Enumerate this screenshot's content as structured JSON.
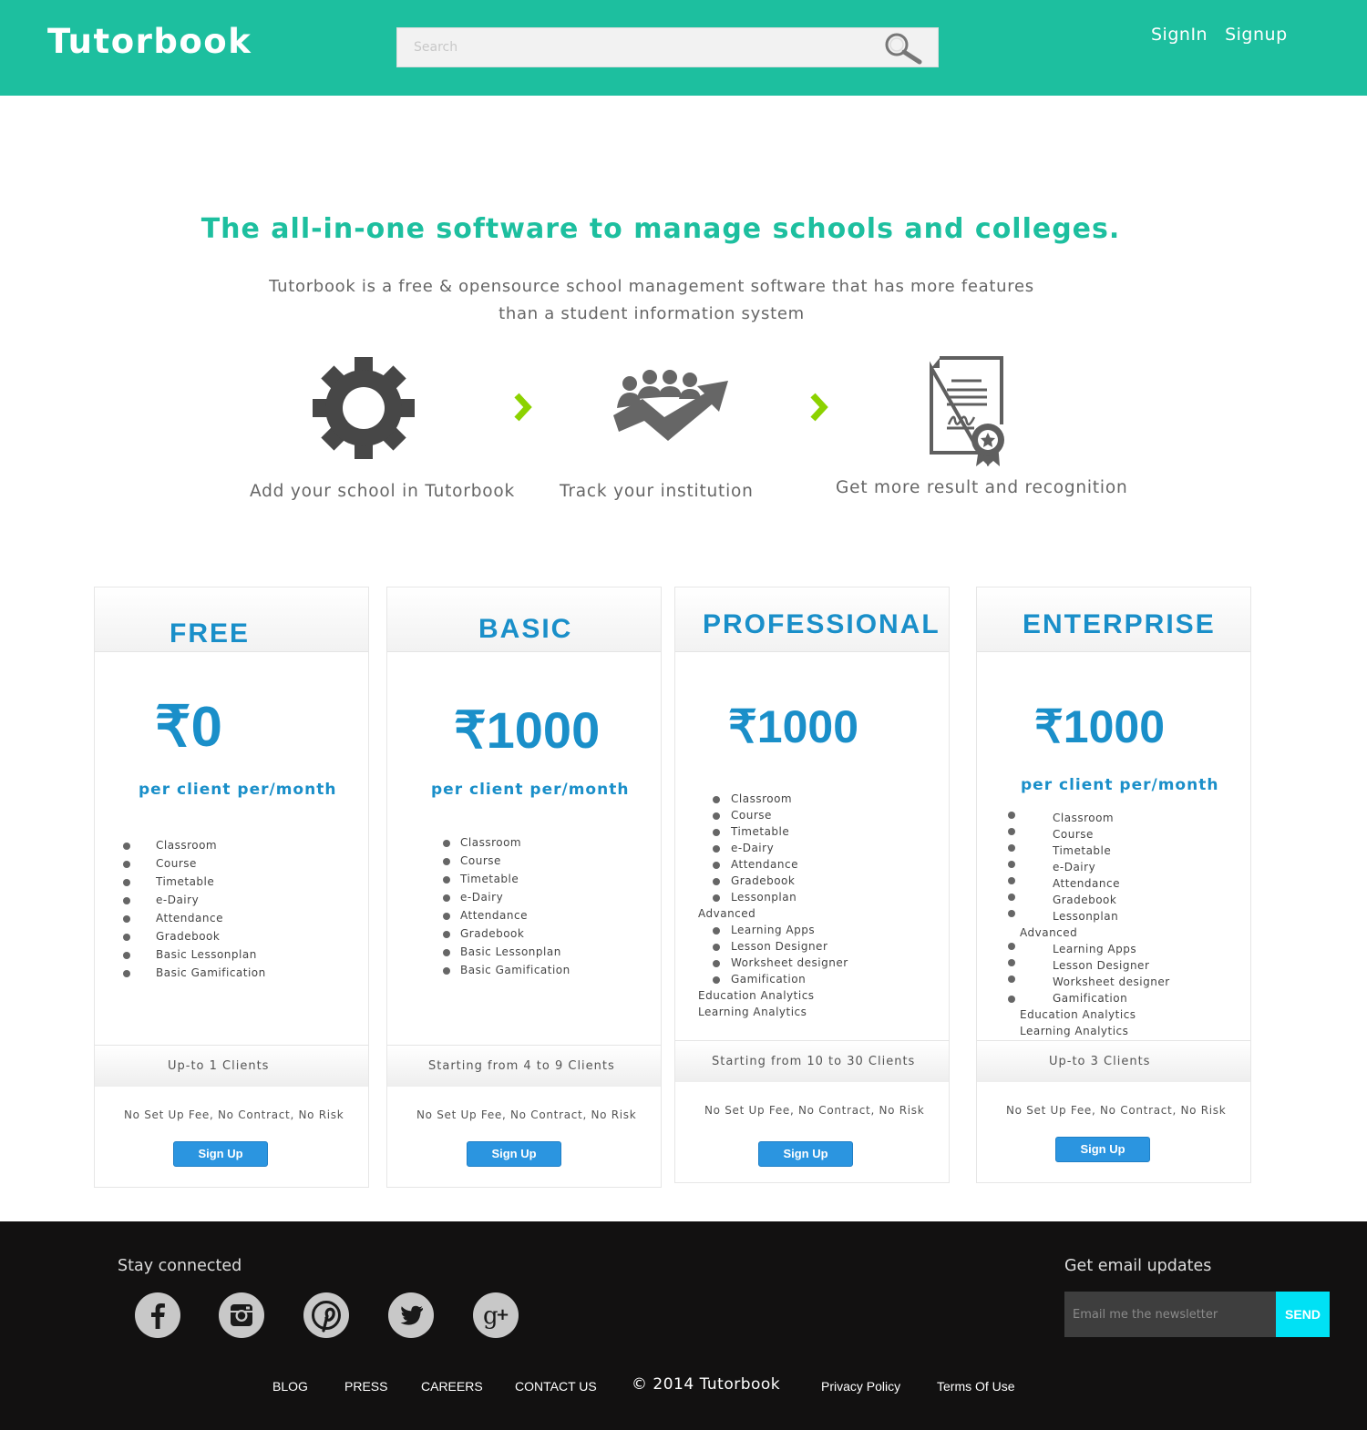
{
  "header": {
    "brand": "Tutorbook",
    "search_placeholder": "Search",
    "nav": {
      "signin": "SignIn",
      "signup": "Signup"
    }
  },
  "hero": {
    "title": "The all-in-one software to manage schools and colleges.",
    "subtitle_line1": "Tutorbook is a free & opensource school management software that has more features",
    "subtitle_line2": "than a student information system"
  },
  "steps": [
    {
      "icon": "gear-icon",
      "label": "Add your school in Tutorbook"
    },
    {
      "icon": "growth-team-icon",
      "label": "Track your institution"
    },
    {
      "icon": "certificate-icon",
      "label": "Get more result and recognition"
    }
  ],
  "colors": {
    "brand_teal": "#1dbf9f",
    "plan_blue": "#1a8fc9",
    "button_blue": "#2b95e0",
    "arrow_green": "#8cd200",
    "send_cyan": "#00e1f5",
    "footer_bg": "#121111"
  },
  "plans": [
    {
      "name": "FREE",
      "price": "₹0",
      "period": "per client per/month",
      "features": [
        "Classroom",
        "Course",
        "Timetable",
        "e-Dairy",
        "Attendance",
        "Gradebook",
        "Basic Lessonplan",
        "Basic Gamification"
      ],
      "clients": "Up-to 1  Clients",
      "terms": "No Set Up Fee, No Contract, No Risk",
      "button": "Sign Up"
    },
    {
      "name": "BASIC",
      "price": "₹1000",
      "period": "per client per/month",
      "features": [
        "Classroom",
        "Course",
        "Timetable",
        "e-Dairy",
        "Attendance",
        "Gradebook",
        "Basic Lessonplan",
        "Basic Gamification"
      ],
      "clients": "Starting from 4 to 9  Clients",
      "terms": "No Set Up Fee, No Contract, No Risk",
      "button": "Sign Up"
    },
    {
      "name": "PROFESSIONAL",
      "price": "₹1000",
      "features": [
        "Classroom",
        "Course",
        "Timetable",
        "e-Dairy",
        "Attendance",
        "Gradebook",
        "Lessonplan"
      ],
      "advanced_label": "Advanced",
      "advanced": [
        "Learning Apps",
        "Lesson Designer",
        "Worksheet designer",
        "Gamification"
      ],
      "extras": [
        "Education Analytics",
        "Learning Analytics"
      ],
      "clients": "Starting from 10 to 30   Clients",
      "terms": "No Set Up Fee, No Contract, No Risk",
      "button": "Sign Up"
    },
    {
      "name": "ENTERPRISE",
      "price": "₹1000",
      "period": "per client per/month",
      "features": [
        "Classroom",
        "Course",
        "Timetable",
        "e-Dairy",
        "Attendance",
        "Gradebook",
        "Lessonplan"
      ],
      "advanced_label": "Advanced",
      "advanced": [
        "Learning Apps",
        "Lesson Designer",
        "Worksheet designer",
        "Gamification"
      ],
      "extras": [
        "Education Analytics",
        "Learning Analytics"
      ],
      "clients": "Up-to 3  Clients",
      "terms": "No Set Up Fee, No Contract, No Risk",
      "button": "Sign Up"
    }
  ],
  "footer": {
    "stay_connected": "Stay connected",
    "social": [
      "facebook-icon",
      "instagram-icon",
      "pinterest-icon",
      "twitter-icon",
      "google-plus-icon"
    ],
    "email_heading": "Get email updates",
    "email_placeholder": "Email me the newsletter",
    "send": "SEND",
    "links": [
      "BLOG",
      "PRESS",
      "CAREERS",
      "CONTACT US"
    ],
    "copyright": "© 2014 Tutorbook",
    "legal": [
      "Privacy Policy",
      "Terms Of Use"
    ]
  }
}
